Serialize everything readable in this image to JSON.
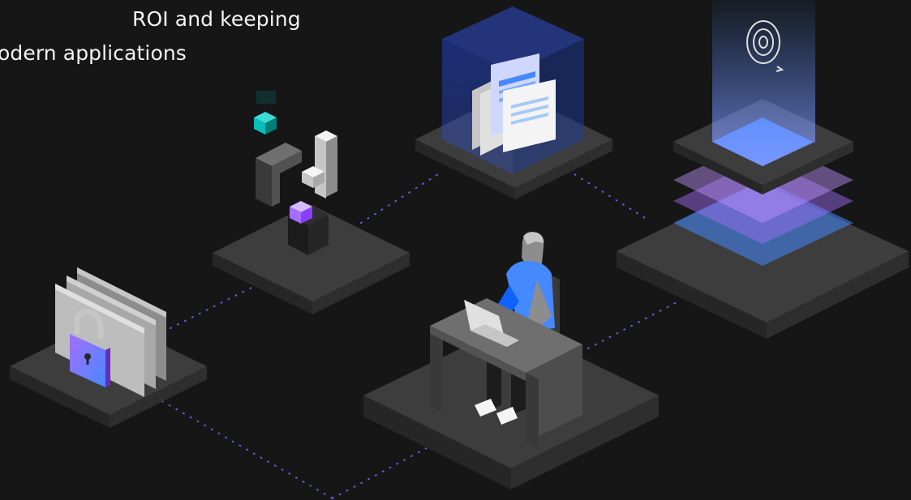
{
  "hero": {
    "line1": "ROI and keeping",
    "line2": "odern applications"
  },
  "colors": {
    "background": "#161616",
    "text": "#f4f4f4",
    "platform_top": "#3d3d3d",
    "platform_left": "#262626",
    "platform_right": "#2e2e2e",
    "accent_blue": "#4589ff",
    "accent_purple": "#a56eff",
    "accent_teal": "#08bdba",
    "dotted_line": "#6f6fff"
  },
  "icons": [
    "padlock-icon",
    "document-stack-icon",
    "sync-target-icon",
    "building-blocks-icon",
    "laptop-icon",
    "person-icon"
  ]
}
